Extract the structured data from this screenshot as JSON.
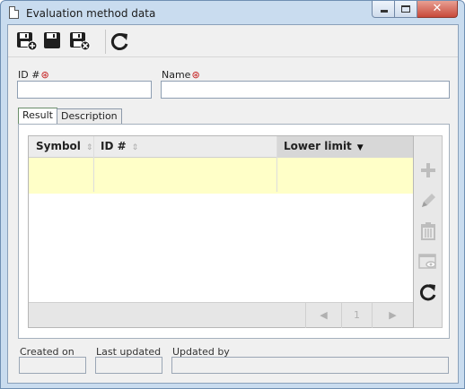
{
  "window": {
    "title": "Evaluation method data",
    "minimize_icon": "minimize-icon",
    "maximize_icon": "maximize-icon",
    "close_icon": "close-icon",
    "close_glyph": "✕"
  },
  "toolbar": {
    "buttons": [
      {
        "name": "save-and-new-button",
        "icon": "save-new-icon"
      },
      {
        "name": "save-button",
        "icon": "save-icon"
      },
      {
        "name": "save-and-close-button",
        "icon": "save-close-icon"
      },
      {
        "name": "refresh-button",
        "icon": "refresh-icon"
      }
    ]
  },
  "form": {
    "id_label": "ID #",
    "id_value": "",
    "name_label": "Name",
    "name_value": "",
    "required_marker": "⊛"
  },
  "tabs": [
    {
      "label": "Result",
      "active": true
    },
    {
      "label": "Description",
      "active": false
    }
  ],
  "grid": {
    "columns": [
      {
        "label": "Symbol",
        "sort_glyph": "⇕"
      },
      {
        "label": "ID #",
        "sort_glyph": "⇕"
      },
      {
        "label": "Lower limit",
        "sort_glyph": "▼"
      }
    ],
    "rows": [
      {
        "symbol": "",
        "id": "",
        "lower_limit": ""
      }
    ],
    "pager": {
      "prev_glyph": "◀",
      "page": "1",
      "next_glyph": "▶"
    },
    "side_buttons": [
      {
        "name": "add-button",
        "icon": "plus-icon"
      },
      {
        "name": "edit-button",
        "icon": "pencil-icon"
      },
      {
        "name": "delete-button",
        "icon": "trash-icon"
      },
      {
        "name": "view-button",
        "icon": "view-icon"
      },
      {
        "name": "refresh-grid-button",
        "icon": "refresh-icon"
      }
    ]
  },
  "footer": {
    "created_on_label": "Created on",
    "created_on_value": "",
    "last_updated_label": "Last updated",
    "last_updated_value": "",
    "updated_by_label": "Updated by",
    "updated_by_value": ""
  },
  "colors": {
    "selected_row": "#ffffc8",
    "required_marker": "#c41919",
    "active_tab_border": "#6a8e6a"
  }
}
